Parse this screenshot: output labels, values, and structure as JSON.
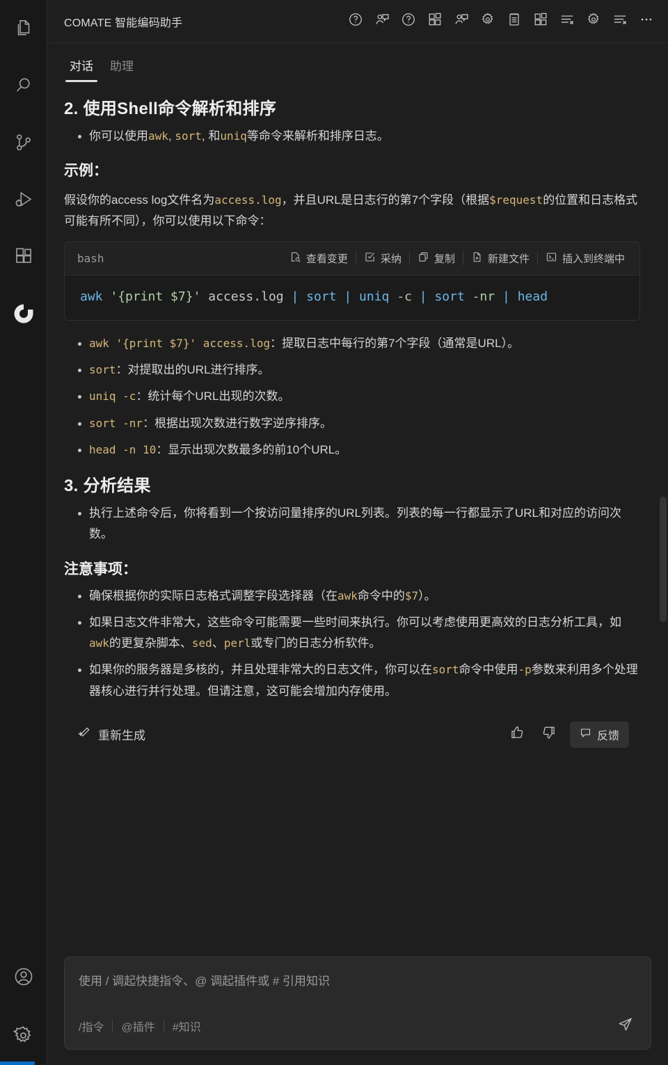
{
  "activity_bar": {
    "items": [
      {
        "name": "explorer",
        "icon": "files-icon"
      },
      {
        "name": "search",
        "icon": "search-icon"
      },
      {
        "name": "source-control",
        "icon": "source-control-icon"
      },
      {
        "name": "run-and-debug",
        "icon": "run-debug-icon"
      },
      {
        "name": "extensions",
        "icon": "extensions-icon"
      },
      {
        "name": "comate",
        "icon": "comate-logo-icon"
      }
    ],
    "bottom_items": [
      {
        "name": "accounts",
        "icon": "account-icon"
      },
      {
        "name": "manage",
        "icon": "gear-icon"
      }
    ]
  },
  "titlebar": {
    "title": "COMATE 智能编码助手",
    "actions": [
      {
        "name": "help",
        "icon": "question-circle-icon",
        "tooltip": "帮助"
      },
      {
        "name": "user-feedback",
        "icon": "person-chat-icon",
        "tooltip": "反馈"
      },
      {
        "name": "help-2",
        "icon": "question-circle-icon",
        "tooltip": "帮助"
      },
      {
        "name": "layout-panel",
        "icon": "layout-blocks-icon",
        "tooltip": "布局"
      },
      {
        "name": "mention-user",
        "icon": "person-chat-icon",
        "tooltip": "提问"
      },
      {
        "name": "settings",
        "icon": "gear-icon",
        "tooltip": "设置"
      },
      {
        "name": "notebook",
        "icon": "notebook-icon",
        "tooltip": "笔记"
      },
      {
        "name": "layout-panel-2",
        "icon": "layout-blocks-icon",
        "tooltip": "布局"
      },
      {
        "name": "clear-list",
        "icon": "list-clear-icon",
        "tooltip": "清空"
      },
      {
        "name": "settings-2",
        "icon": "gear-icon",
        "tooltip": "设置"
      },
      {
        "name": "clear-list-2",
        "icon": "list-clear-icon",
        "tooltip": "清空"
      },
      {
        "name": "more",
        "icon": "ellipsis-icon",
        "tooltip": "更多"
      }
    ]
  },
  "tabs": [
    {
      "label": "对话",
      "active": true
    },
    {
      "label": "助理",
      "active": false
    }
  ],
  "message": {
    "section2_heading": "2. 使用Shell命令解析和排序",
    "section2_bullet": {
      "prefix": "你可以使用",
      "code1": "awk",
      "mid1": ", ",
      "code2": "sort",
      "mid2": ", 和",
      "code3": "uniq",
      "suffix": "等命令来解析和排序日志。"
    },
    "example_heading": "示例：",
    "example_paragraph": {
      "p1": "假设你的access log文件名为",
      "c1": "access.log",
      "p2": "，并且URL是日志行的第7个字段（根据",
      "c2": "$request",
      "p3": "的位置和日志格式可能有所不同），你可以使用以下命令："
    },
    "codeblock": {
      "language": "bash",
      "actions": [
        {
          "label": "查看变更",
          "icon": "diff-view-icon"
        },
        {
          "label": "采纳",
          "icon": "check-box-icon"
        },
        {
          "label": "复制",
          "icon": "copy-icon"
        },
        {
          "label": "新建文件",
          "icon": "new-file-icon"
        },
        {
          "label": "插入到终端中",
          "icon": "terminal-icon"
        }
      ],
      "tokens": [
        {
          "t": "awk",
          "k": "cmd"
        },
        {
          "t": " ",
          "k": "plain"
        },
        {
          "t": "'{print $7}'",
          "k": "str"
        },
        {
          "t": " access.log ",
          "k": "plain"
        },
        {
          "t": "|",
          "k": "pipe"
        },
        {
          "t": " ",
          "k": "plain"
        },
        {
          "t": "sort",
          "k": "cmd"
        },
        {
          "t": " ",
          "k": "plain"
        },
        {
          "t": "|",
          "k": "pipe"
        },
        {
          "t": " ",
          "k": "plain"
        },
        {
          "t": "uniq",
          "k": "cmd"
        },
        {
          "t": " ",
          "k": "plain"
        },
        {
          "t": "-c",
          "k": "flag"
        },
        {
          "t": " ",
          "k": "plain"
        },
        {
          "t": "|",
          "k": "pipe"
        },
        {
          "t": " ",
          "k": "plain"
        },
        {
          "t": "sort",
          "k": "cmd"
        },
        {
          "t": " ",
          "k": "plain"
        },
        {
          "t": "-nr",
          "k": "flag"
        },
        {
          "t": " ",
          "k": "plain"
        },
        {
          "t": "|",
          "k": "pipe"
        },
        {
          "t": " ",
          "k": "plain"
        },
        {
          "t": "head",
          "k": "cmd"
        }
      ],
      "plain_text": "awk '{print $7}' access.log | sort | uniq -c | sort -nr | head"
    },
    "explain_list": [
      {
        "code": "awk '{print $7}' access.log",
        "text": "：提取日志中每行的第7个字段（通常是URL）。"
      },
      {
        "code": "sort",
        "text": "：对提取出的URL进行排序。"
      },
      {
        "code": "uniq -c",
        "text": "：统计每个URL出现的次数。"
      },
      {
        "code": "sort -nr",
        "text": "：根据出现次数进行数字逆序排序。"
      },
      {
        "code": "head -n 10",
        "text": "：显示出现次数最多的前10个URL。"
      }
    ],
    "section3_heading": "3. 分析结果",
    "section3_bullet": "执行上述命令后，你将看到一个按访问量排序的URL列表。列表的每一行都显示了URL和对应的访问次数。",
    "notes_heading": "注意事项：",
    "notes": [
      {
        "p1": "确保根据你的实际日志格式调整字段选择器（在",
        "c1": "awk",
        "p2": "命令中的",
        "c2": "$7",
        "p3": "）。"
      },
      {
        "p1": "如果日志文件非常大，这些命令可能需要一些时间来执行。你可以考虑使用更高效的日志分析工具，如",
        "c1": "awk",
        "p2": "的更复杂脚本、",
        "c2": "sed",
        "p3": "、",
        "c3": "perl",
        "p4": "或专门的日志分析软件。"
      },
      {
        "p1": "如果你的服务器是多核的，并且处理非常大的日志文件，你可以在",
        "c1": "sort",
        "p2": "命令中使用",
        "c2": "-p",
        "p3": "参数来利用多个处理器核心进行并行处理。但请注意，这可能会增加内存使用。"
      }
    ],
    "footer": {
      "regenerate_label": "重新生成",
      "regenerate_icon": "sparkle-icon",
      "thumbs_up_icon": "thumbs-up-icon",
      "thumbs_down_icon": "thumbs-down-icon",
      "feedback_label": "反馈",
      "feedback_icon": "comment-icon"
    }
  },
  "composer": {
    "placeholder": "使用 / 调起快捷指令、@ 调起插件或 # 引用知识",
    "value": "",
    "chips": [
      {
        "label": "/指令"
      },
      {
        "label": "@插件"
      },
      {
        "label": "#知识"
      }
    ],
    "send_icon": "send-icon"
  },
  "colors": {
    "background": "#1e1e1e",
    "activity_bar": "#181818",
    "code_block_bg": "#1b1b1b",
    "code_header_bg": "#222222",
    "composer_bg": "#2a2a2a",
    "inline_code": "#d6b77a",
    "code_command": "#6cb6e8",
    "code_string": "#b5cea8",
    "status_accent": "#0a6cc4"
  }
}
